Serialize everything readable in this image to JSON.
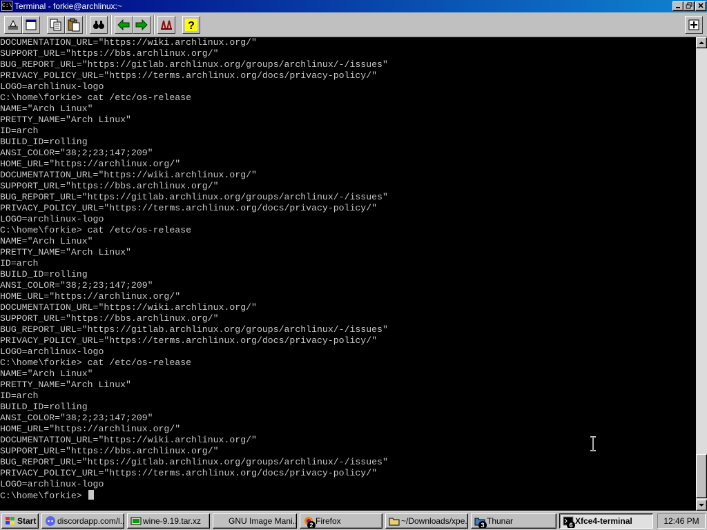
{
  "window": {
    "title": "Terminal - forkie@archlinux:~",
    "icon_text": "C:\\"
  },
  "toolbar": {
    "buttons": [
      {
        "name": "mark-icon"
      },
      {
        "name": "fullscreen-icon"
      },
      {
        "name": "copy-icon"
      },
      {
        "name": "paste-icon"
      },
      {
        "name": "find-icon"
      },
      {
        "name": "back-icon"
      },
      {
        "name": "forward-icon"
      },
      {
        "name": "font-icon"
      },
      {
        "name": "help-icon"
      },
      {
        "name": "properties-icon"
      }
    ]
  },
  "terminal": {
    "lines": [
      "DOCUMENTATION_URL=\"https://wiki.archlinux.org/\"",
      "SUPPORT_URL=\"https://bbs.archlinux.org/\"",
      "BUG_REPORT_URL=\"https://gitlab.archlinux.org/groups/archlinux/-/issues\"",
      "PRIVACY_POLICY_URL=\"https://terms.archlinux.org/docs/privacy-policy/\"",
      "LOGO=archlinux-logo",
      "C:\\home\\forkie> cat /etc/os-release",
      "NAME=\"Arch Linux\"",
      "PRETTY_NAME=\"Arch Linux\"",
      "ID=arch",
      "BUILD_ID=rolling",
      "ANSI_COLOR=\"38;2;23;147;209\"",
      "HOME_URL=\"https://archlinux.org/\"",
      "DOCUMENTATION_URL=\"https://wiki.archlinux.org/\"",
      "SUPPORT_URL=\"https://bbs.archlinux.org/\"",
      "BUG_REPORT_URL=\"https://gitlab.archlinux.org/groups/archlinux/-/issues\"",
      "PRIVACY_POLICY_URL=\"https://terms.archlinux.org/docs/privacy-policy/\"",
      "LOGO=archlinux-logo",
      "C:\\home\\forkie> cat /etc/os-release",
      "NAME=\"Arch Linux\"",
      "PRETTY_NAME=\"Arch Linux\"",
      "ID=arch",
      "BUILD_ID=rolling",
      "ANSI_COLOR=\"38;2;23;147;209\"",
      "HOME_URL=\"https://archlinux.org/\"",
      "DOCUMENTATION_URL=\"https://wiki.archlinux.org/\"",
      "SUPPORT_URL=\"https://bbs.archlinux.org/\"",
      "BUG_REPORT_URL=\"https://gitlab.archlinux.org/groups/archlinux/-/issues\"",
      "PRIVACY_POLICY_URL=\"https://terms.archlinux.org/docs/privacy-policy/\"",
      "LOGO=archlinux-logo",
      "C:\\home\\forkie> cat /etc/os-release",
      "NAME=\"Arch Linux\"",
      "PRETTY_NAME=\"Arch Linux\"",
      "ID=arch",
      "BUILD_ID=rolling",
      "ANSI_COLOR=\"38;2;23;147;209\"",
      "HOME_URL=\"https://archlinux.org/\"",
      "DOCUMENTATION_URL=\"https://wiki.archlinux.org/\"",
      "SUPPORT_URL=\"https://bbs.archlinux.org/\"",
      "BUG_REPORT_URL=\"https://gitlab.archlinux.org/groups/archlinux/-/issues\"",
      "PRIVACY_POLICY_URL=\"https://terms.archlinux.org/docs/privacy-policy/\"",
      "LOGO=archlinux-logo"
    ],
    "prompt": "C:\\home\\forkie> ",
    "text_color": "#c8c8c8",
    "background": "#000000"
  },
  "taskbar": {
    "start_label": "Start",
    "tasks": [
      {
        "label": "discordapp.com/l...",
        "icon": "discord-icon",
        "badge": ""
      },
      {
        "label": "wine-9.19.tar.xz",
        "icon": "archive-icon",
        "badge": ""
      },
      {
        "label": "GNU Image Mani...",
        "icon": "",
        "badge": ""
      },
      {
        "label": "Firefox",
        "icon": "firefox-icon",
        "badge": "2"
      },
      {
        "label": "~/Downloads/xpe...",
        "icon": "folder-icon",
        "badge": ""
      },
      {
        "label": "Thunar",
        "icon": "thunar-icon",
        "badge": "3"
      },
      {
        "label": "Xfce4-terminal",
        "icon": "terminal-icon",
        "badge": "6"
      }
    ],
    "clock": "12:46 PM"
  },
  "colors": {
    "title_active": "#000080",
    "face": "#c0c0c0"
  }
}
